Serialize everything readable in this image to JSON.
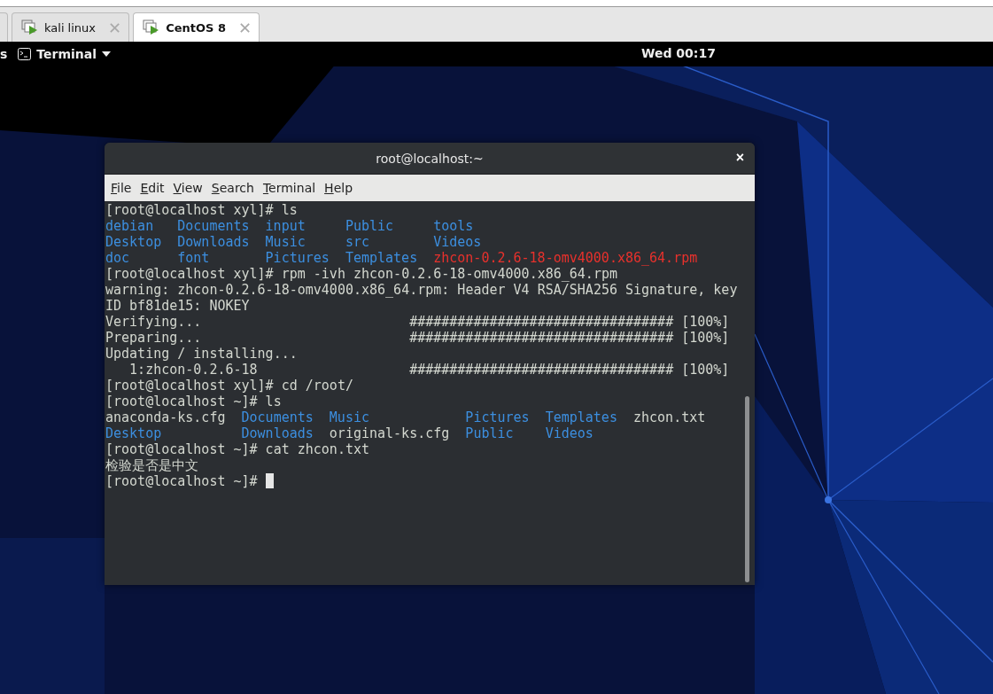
{
  "vm_tabs": [
    {
      "label": "kali linux",
      "close": "✕",
      "selected": false
    },
    {
      "label": "CentOS 8",
      "close": "✕",
      "selected": true
    }
  ],
  "top_bar": {
    "activities": "s",
    "app_menu": "Terminal",
    "clock": "Wed 00:17"
  },
  "terminal": {
    "title": "root@localhost:~",
    "close": "×",
    "menu": [
      "File",
      "Edit",
      "View",
      "Search",
      "Terminal",
      "Help"
    ],
    "lines": [
      {
        "kind": "text",
        "text": "[root@localhost xyl]# ls"
      },
      {
        "kind": "ls",
        "rows": [
          [
            {
              "name": "debian",
              "color": "#3c8fe0"
            },
            {
              "name": "Documents",
              "color": "#3c8fe0"
            },
            {
              "name": "input",
              "color": "#3c8fe0"
            },
            {
              "name": "Public",
              "color": "#3c8fe0"
            },
            {
              "name": "tools",
              "color": "#3c8fe0"
            }
          ],
          [
            {
              "name": "Desktop",
              "color": "#3c8fe0"
            },
            {
              "name": "Downloads",
              "color": "#3c8fe0"
            },
            {
              "name": "Music",
              "color": "#3c8fe0"
            },
            {
              "name": "src",
              "color": "#3c8fe0"
            },
            {
              "name": "Videos",
              "color": "#3c8fe0"
            }
          ],
          [
            {
              "name": "doc",
              "color": "#3c8fe0"
            },
            {
              "name": "font",
              "color": "#3c8fe0"
            },
            {
              "name": "Pictures",
              "color": "#3c8fe0"
            },
            {
              "name": "Templates",
              "color": "#3c8fe0"
            },
            {
              "name": "zhcon-0.2.6-18-omv4000.x86_64.rpm",
              "color": "#e8312c"
            }
          ]
        ]
      },
      {
        "kind": "text",
        "text": "[root@localhost xyl]# rpm -ivh zhcon-0.2.6-18-omv4000.x86_64.rpm"
      },
      {
        "kind": "text",
        "text": "warning: zhcon-0.2.6-18-omv4000.x86_64.rpm: Header V4 RSA/SHA256 Signature, key"
      },
      {
        "kind": "text",
        "text": "ID bf81de15: NOKEY"
      },
      {
        "kind": "progress",
        "label": "Verifying...",
        "bar": "#################################",
        "percent": "[100%]"
      },
      {
        "kind": "progress",
        "label": "Preparing...",
        "bar": "#################################",
        "percent": "[100%]"
      },
      {
        "kind": "text",
        "text": "Updating / installing..."
      },
      {
        "kind": "progress",
        "label": "   1:zhcon-0.2.6-18",
        "bar": "#################################",
        "percent": "[100%]"
      },
      {
        "kind": "text",
        "text": "[root@localhost xyl]# cd /root/"
      },
      {
        "kind": "text",
        "text": "[root@localhost ~]# ls"
      },
      {
        "kind": "ls",
        "rows": [
          [
            {
              "name": "anaconda-ks.cfg",
              "color": "#d3d7cf"
            },
            {
              "name": "Documents",
              "color": "#3c8fe0"
            },
            {
              "name": "Music",
              "color": "#3c8fe0"
            },
            {
              "name": "Pictures",
              "color": "#3c8fe0"
            },
            {
              "name": "Templates",
              "color": "#3c8fe0"
            },
            {
              "name": "zhcon.txt",
              "color": "#d3d7cf"
            }
          ],
          [
            {
              "name": "Desktop",
              "color": "#3c8fe0"
            },
            {
              "name": "Downloads",
              "color": "#3c8fe0"
            },
            {
              "name": "original-ks.cfg",
              "color": "#d3d7cf"
            },
            {
              "name": "Public",
              "color": "#3c8fe0"
            },
            {
              "name": "Videos",
              "color": "#3c8fe0"
            }
          ]
        ]
      },
      {
        "kind": "text",
        "text": "[root@localhost ~]# cat zhcon.txt"
      },
      {
        "kind": "text",
        "text": "检验是否是中文"
      },
      {
        "kind": "prompt",
        "text": "[root@localhost ~]# ",
        "cursor": true
      }
    ]
  }
}
